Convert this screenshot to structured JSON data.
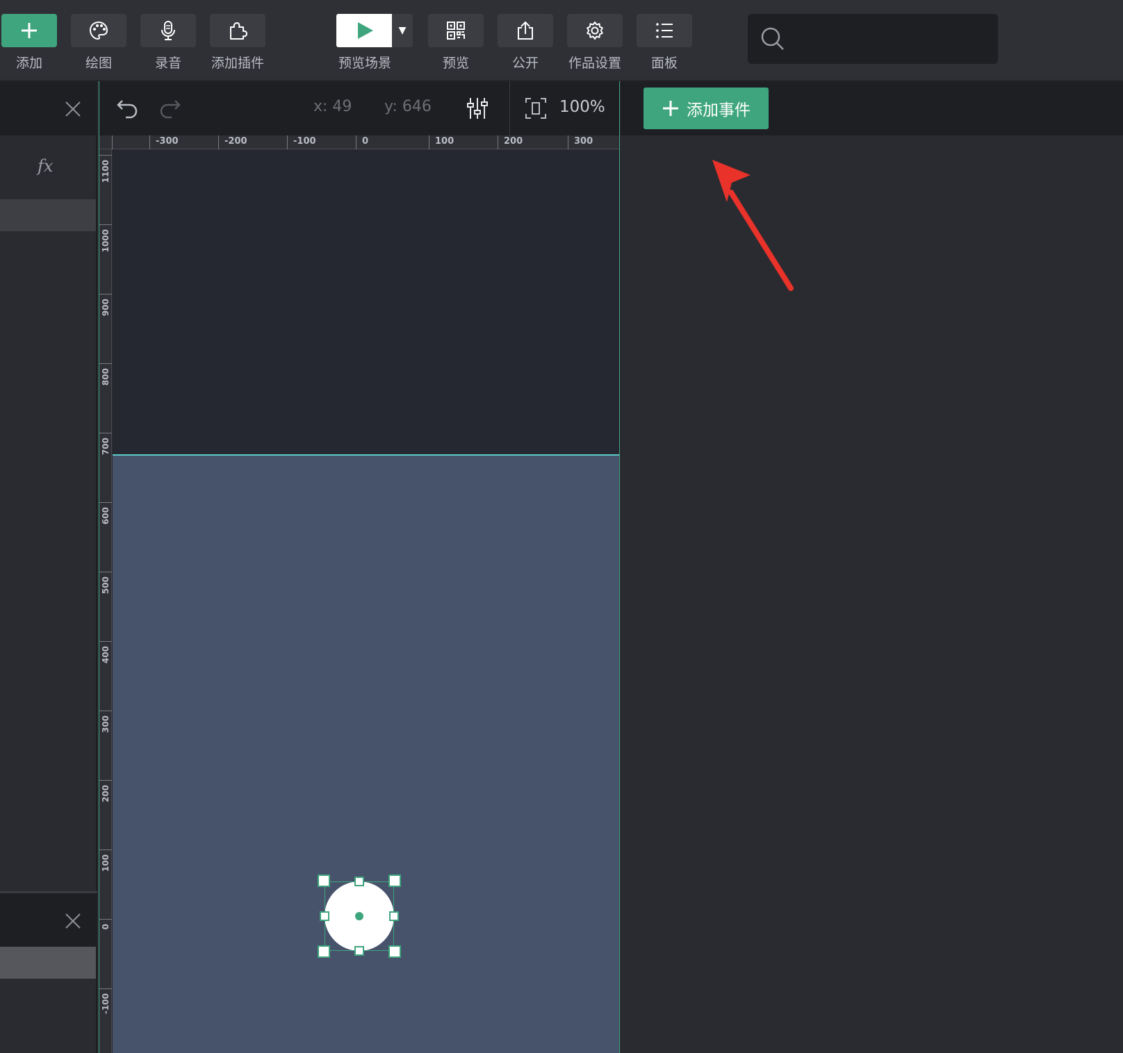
{
  "toolbar": {
    "add_label": "添加",
    "draw_label": "绘图",
    "record_label": "录音",
    "plugin_label": "添加插件",
    "preview_scene_label": "预览场景",
    "preview_label": "预览",
    "publish_label": "公开",
    "settings_label": "作品设置",
    "panel_label": "面板",
    "search_placeholder": ""
  },
  "canvas": {
    "x_readout": "x: 49",
    "y_readout": "y: 646",
    "zoom": "100%",
    "ruler_x": [
      "-300",
      "-200",
      "-100",
      "0",
      "100",
      "200",
      "300"
    ],
    "ruler_y": [
      "1100",
      "1000",
      "900",
      "800",
      "700",
      "600",
      "500",
      "400",
      "300",
      "200",
      "100",
      "0",
      "-100"
    ]
  },
  "events": {
    "add_event_label": "添加事件"
  },
  "colors": {
    "accent": "#3fa57e",
    "stage": "#47536b",
    "annotation_arrow": "#e8322a"
  }
}
